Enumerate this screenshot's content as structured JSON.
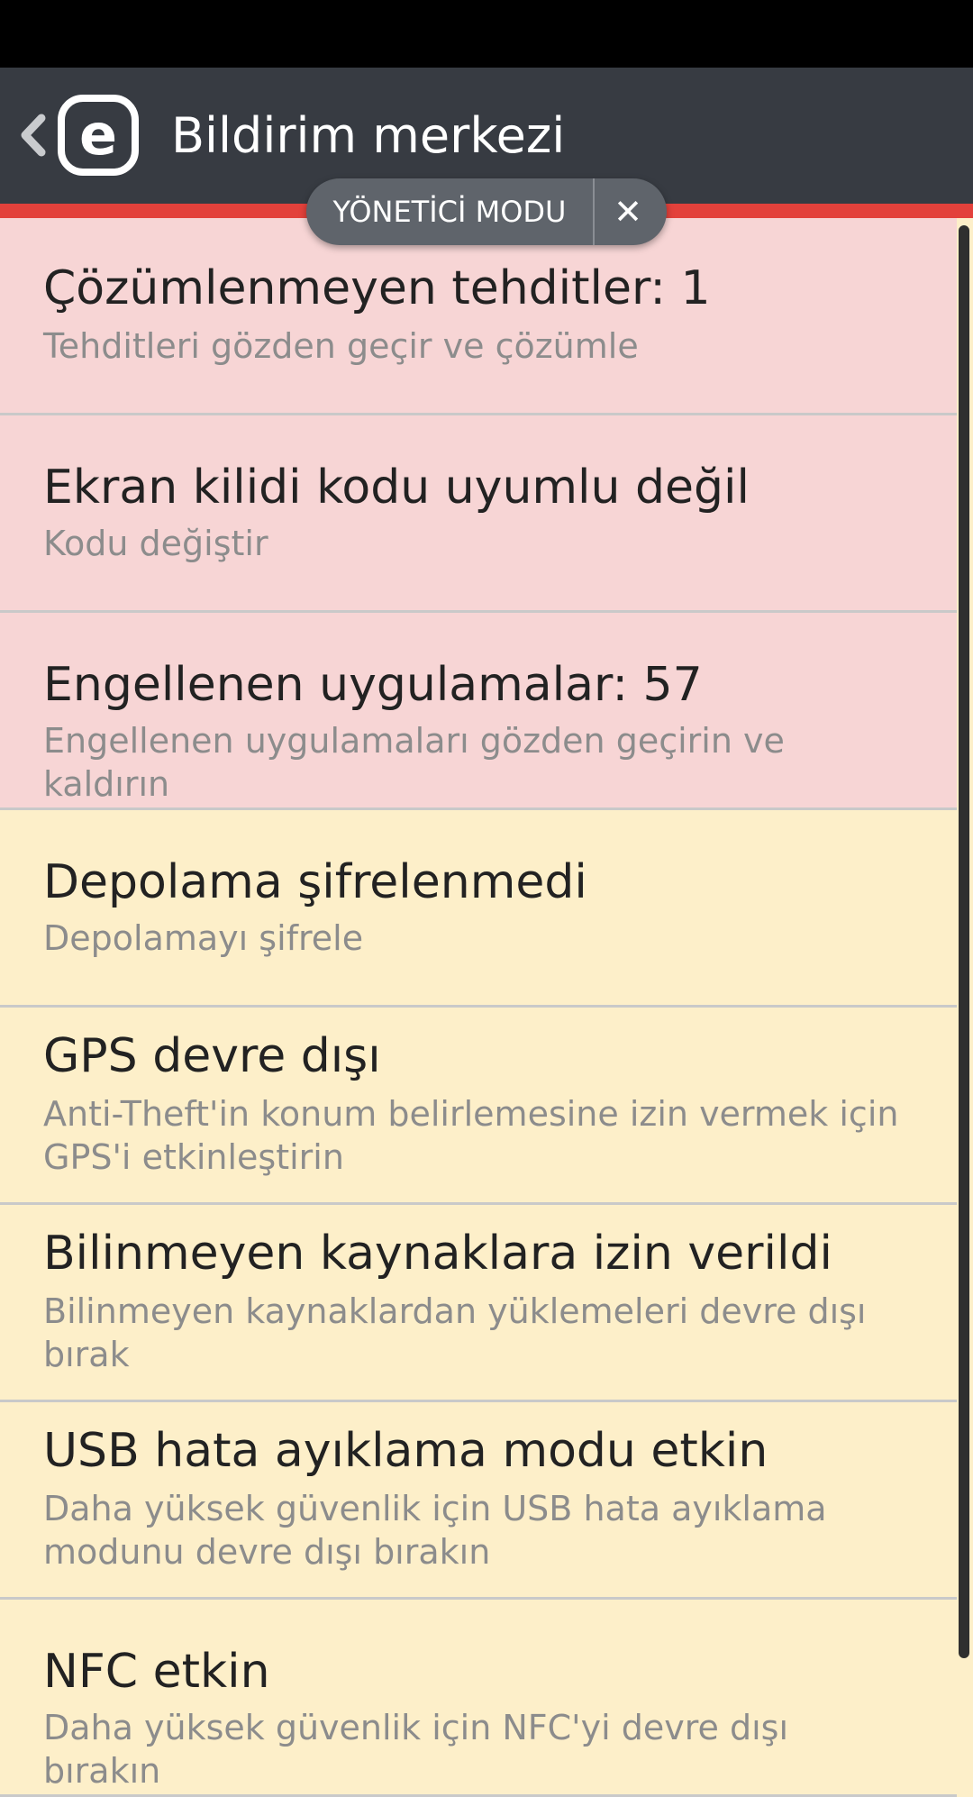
{
  "app_bar": {
    "title": "Bildirim merkezi",
    "back_icon": "chevron-left-icon",
    "logo_letter": "e"
  },
  "admin_mode": {
    "label": "YÖNETİCİ MODU",
    "close_symbol": "✕"
  },
  "colors": {
    "app_bar": "#373b42",
    "accent": "#e3413b",
    "error_bg": "#f7d5d5",
    "warning_bg": "#fdefc9"
  },
  "notifications": [
    {
      "title": "Çözümlenmeyen tehditler: 1",
      "subtitle": "Tehditleri gözden geçir ve çözümle",
      "severity": "error"
    },
    {
      "title": "Ekran kilidi kodu uyumlu değil",
      "subtitle": "Kodu değiştir",
      "severity": "error"
    },
    {
      "title": "Engellenen uygulamalar: 57",
      "subtitle": "Engellenen uygulamaları gözden geçirin ve kaldırın",
      "severity": "error"
    },
    {
      "title": "Depolama şifrelenmedi",
      "subtitle": "Depolamayı şifrele",
      "severity": "warning"
    },
    {
      "title": "GPS devre dışı",
      "subtitle": "Anti-Theft'in konum belirlemesine izin vermek için GPS'i etkinleştirin",
      "severity": "warning"
    },
    {
      "title": "Bilinmeyen kaynaklara izin verildi",
      "subtitle": "Bilinmeyen kaynaklardan yüklemeleri devre dışı bırak",
      "severity": "warning"
    },
    {
      "title": "USB hata ayıklama modu etkin",
      "subtitle": "Daha yüksek güvenlik için USB hata ayıklama modunu devre dışı bırakın",
      "severity": "warning"
    },
    {
      "title": "NFC etkin",
      "subtitle": "Daha yüksek güvenlik için NFC'yi devre dışı bırakın",
      "severity": "warning"
    }
  ]
}
